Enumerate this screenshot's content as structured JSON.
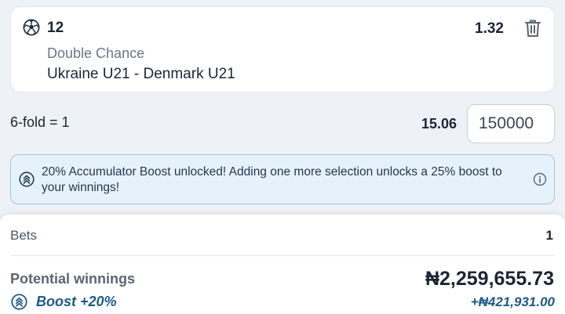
{
  "selection": {
    "pick": "12",
    "odds": "1.32",
    "market": "Double Chance",
    "event": "Ukraine U21 - Denmark U21",
    "sport_icon": "soccer-ball-icon",
    "remove_icon": "trash-icon"
  },
  "accumulator": {
    "fold_label": "6-fold = 1",
    "total_odds": "15.06",
    "stake": "150000"
  },
  "boost_banner": {
    "icon": "boost-icon",
    "text": "20% Accumulator Boost unlocked! Adding one more selection unlocks a 25% boost to your winnings!",
    "info_icon": "info-icon"
  },
  "summary": {
    "bets_label": "Bets",
    "bets_count": "1",
    "potential_winnings_label": "Potential winnings",
    "potential_winnings_value": "₦2,259,655.73",
    "boost_label": "Boost +20%",
    "boost_value": "+₦421,931.00"
  },
  "colors": {
    "boost_text": "#1f5a86",
    "banner_bg": "#e5f2fb",
    "banner_border": "#9fc6e2",
    "page_bg": "#eef1f5"
  }
}
